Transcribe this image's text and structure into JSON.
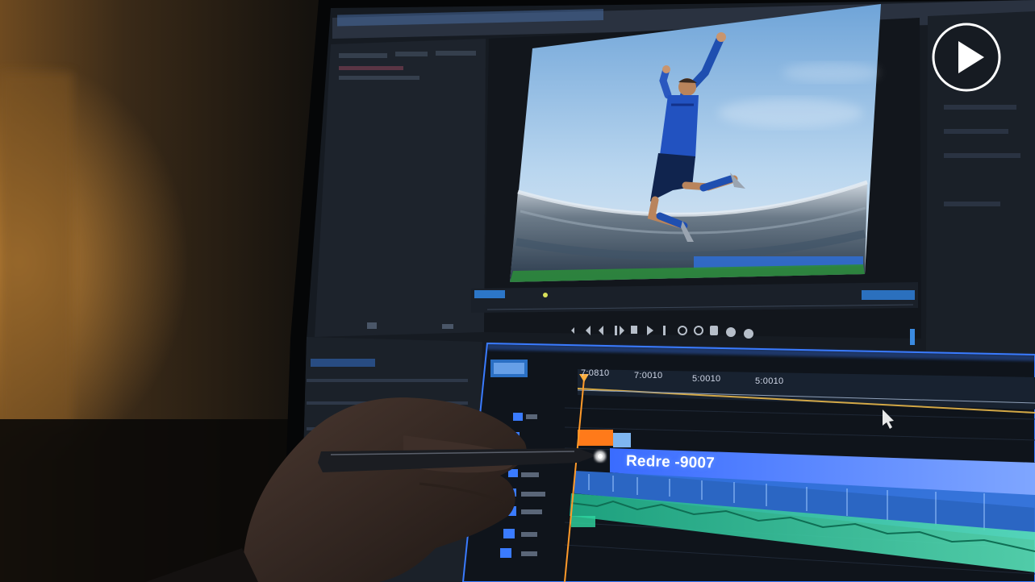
{
  "timeline": {
    "timecodes": [
      "7:0810",
      "7:0010",
      "5:0010",
      "5:0010"
    ],
    "clip_title": "Redre -9007"
  },
  "overlay": {
    "icon": "play-icon",
    "color": "#ffffff"
  },
  "colors": {
    "accent_blue": "#3a7bff",
    "playhead_orange": "#ff7a1a",
    "audio_green": "#2fd6a0",
    "sky": "#9fc6ea"
  }
}
